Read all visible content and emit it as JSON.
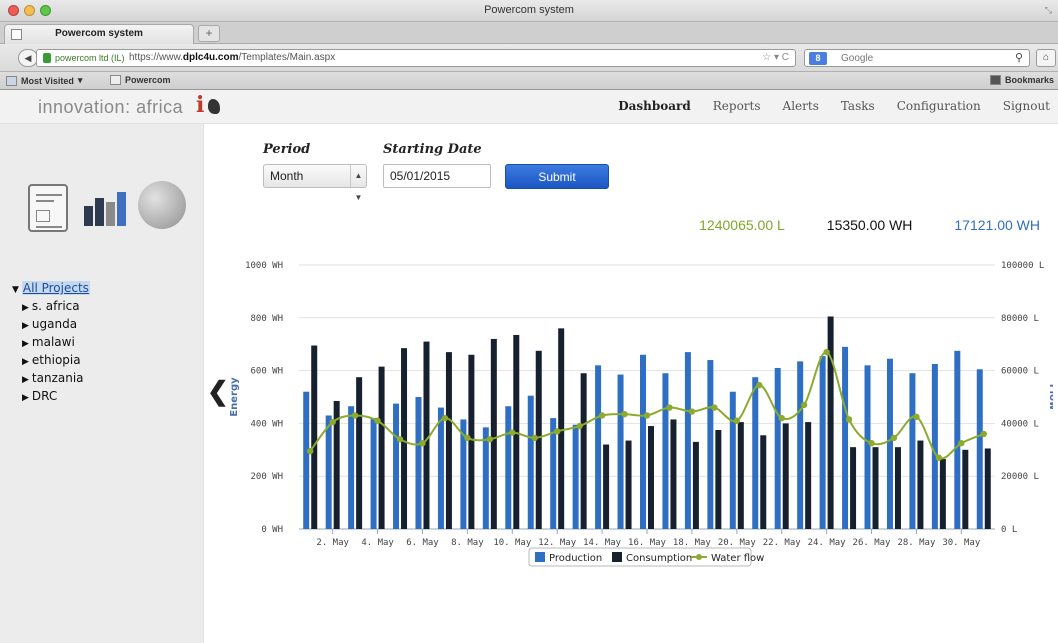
{
  "browser": {
    "window_title": "Powercom system",
    "tab_title": "Powercom system",
    "new_tab_label": "+",
    "url_site": "powercom ltd (IL)",
    "url_prefix": "https://www.",
    "url_domain": "dplc4u.com",
    "url_path": "/Templates/Main.aspx",
    "search_placeholder": "Google",
    "search_engine": "8",
    "bookmarks": [
      "Most Visited",
      "Powercom"
    ],
    "bookmarks_menu": "Bookmarks"
  },
  "app": {
    "brand": "innovation: africa",
    "brand_mark": "i",
    "menu": [
      "Dashboard",
      "Reports",
      "Alerts",
      "Tasks",
      "Configuration",
      "Signout"
    ],
    "active_menu": "Dashboard"
  },
  "sidebar": {
    "tree_root": "All Projects",
    "projects": [
      "s. africa",
      "uganda",
      "malawi",
      "ethiopia",
      "tanzania",
      "DRC"
    ]
  },
  "form": {
    "period_label": "Period",
    "period_value": "Month",
    "date_label": "Starting Date",
    "date_value": "05/01/2015",
    "submit_label": "Submit"
  },
  "totals": {
    "water": "1240065.00 L",
    "consumption": "15350.00 WH",
    "production": "17121.00 WH"
  },
  "colors": {
    "production": "#2f6fc3",
    "consumption": "#17202e",
    "water": "#8cab2e"
  },
  "chart_data": {
    "type": "bar",
    "ylabel": "Energy",
    "y2label": "Flow",
    "ylim": [
      0,
      1000
    ],
    "y2lim": [
      0,
      100000
    ],
    "yticks": [
      "0 WH",
      "200 WH",
      "400 WH",
      "600 WH",
      "800 WH",
      "1000 WH"
    ],
    "y2ticks": [
      "0 L",
      "20000 L",
      "40000 L",
      "60000 L",
      "80000 L",
      "100000 L"
    ],
    "categories": [
      "1. May",
      "2. May",
      "3. May",
      "4. May",
      "5. May",
      "6. May",
      "7. May",
      "8. May",
      "9. May",
      "10. May",
      "11. May",
      "12. May",
      "13. May",
      "14. May",
      "15. May",
      "16. May",
      "17. May",
      "18. May",
      "19. May",
      "20. May",
      "21. May",
      "22. May",
      "23. May",
      "24. May",
      "25. May",
      "26. May",
      "27. May",
      "28. May",
      "29. May",
      "30. May",
      "31. May"
    ],
    "xtick_labels": [
      "2. May",
      "4. May",
      "6. May",
      "8. May",
      "10. May",
      "12. May",
      "14. May",
      "16. May",
      "18. May",
      "20. May",
      "22. May",
      "24. May",
      "26. May",
      "28. May",
      "30. May"
    ],
    "series": [
      {
        "name": "Production",
        "axis": "left",
        "type": "bar",
        "values": [
          520,
          430,
          465,
          420,
          475,
          500,
          460,
          415,
          385,
          465,
          505,
          420,
          395,
          620,
          585,
          660,
          590,
          670,
          640,
          520,
          575,
          610,
          635,
          655,
          690,
          620,
          645,
          590,
          625,
          675,
          605
        ]
      },
      {
        "name": "Consumption",
        "axis": "left",
        "type": "bar",
        "values": [
          695,
          485,
          575,
          615,
          685,
          710,
          670,
          660,
          720,
          735,
          675,
          760,
          590,
          320,
          335,
          390,
          415,
          330,
          375,
          405,
          355,
          400,
          405,
          805,
          310,
          310,
          310,
          335,
          265,
          300,
          305
        ]
      },
      {
        "name": "Water flow",
        "axis": "right",
        "type": "line",
        "values": [
          29500,
          40500,
          43000,
          41000,
          34000,
          32500,
          42000,
          34500,
          34000,
          36500,
          34500,
          37000,
          39000,
          43000,
          43500,
          43000,
          46000,
          44500,
          46000,
          41000,
          54500,
          42000,
          47000,
          67000,
          41500,
          32500,
          34500,
          42500,
          27000,
          32500,
          36000
        ]
      }
    ],
    "legend": "bottom-center",
    "grid": true
  }
}
